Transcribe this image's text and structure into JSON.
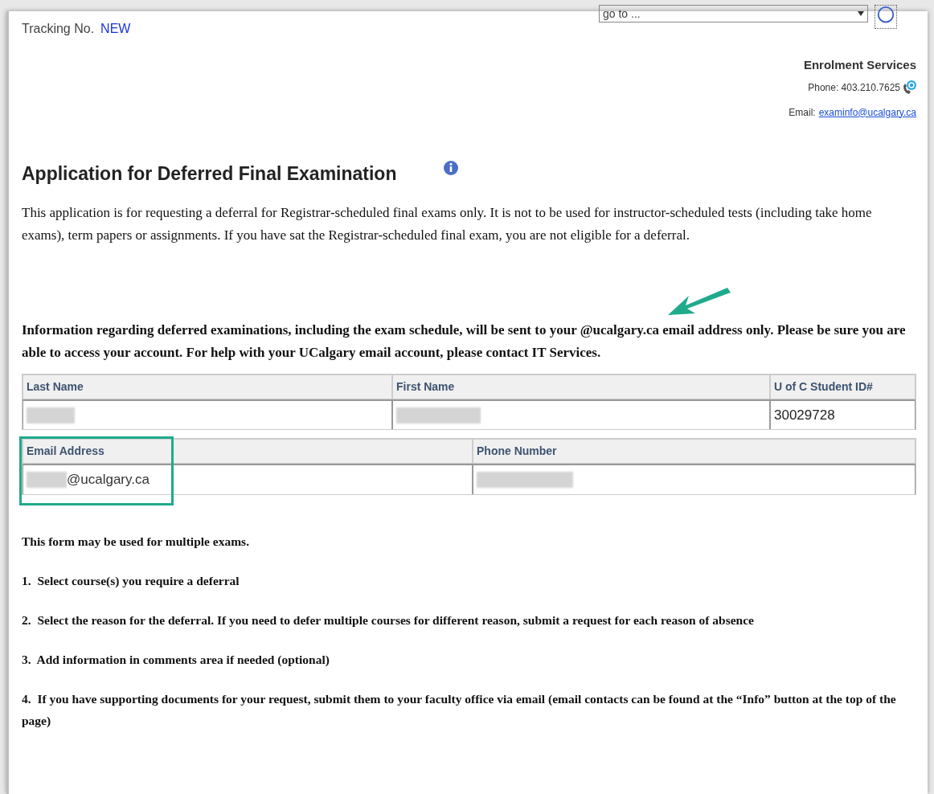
{
  "header": {
    "tracking_label": "Tracking No.",
    "tracking_value": "NEW",
    "goto": {
      "value": "go to ..."
    }
  },
  "contact": {
    "office": "Enrolment Services",
    "phone": "Phone: 403.210.7625",
    "email_label": "Email:",
    "email": "examinfo@ucalgary.ca"
  },
  "title": "Application for Deferred Final Examination",
  "intro": "This application is for requesting a deferral for Registrar-scheduled final exams only.  It is not to be used for instructor-scheduled tests (including take home exams), term papers or assignments.  If you have sat the Registrar-scheduled final exam, you are not eligible for a deferral.",
  "notice": "Information regarding deferred examinations, including the exam schedule, will be sent to your @ucalgary.ca email address only. Please be sure you are able to access your account. For help with your UCalgary email account, please contact IT Services.",
  "table1": {
    "columns": [
      "Last Name",
      "First Name",
      "U of C Student ID#"
    ],
    "cells": [
      {
        "kind": "redacted"
      },
      {
        "kind": "redacted"
      },
      {
        "kind": "text",
        "value": "30029728"
      }
    ]
  },
  "table2": {
    "columns": [
      "Email Address",
      "Phone Number"
    ],
    "cells": [
      {
        "kind": "redacted",
        "value": "@ucalgary.ca"
      },
      {
        "kind": "redacted"
      }
    ]
  },
  "instructions": [
    "This form may be used for multiple exams.",
    "1.  Select course(s) you require a deferral",
    "2.  Select the reason for the deferral. If you need to defer multiple courses for different reason, submit a request for each reason of absence",
    "3.  Add information in comments area if needed (optional)",
    "4.  If you have supporting documents for your request, submit them to your faculty office via email (email contacts can be found at the “Info” button at the top of the page)"
  ]
}
